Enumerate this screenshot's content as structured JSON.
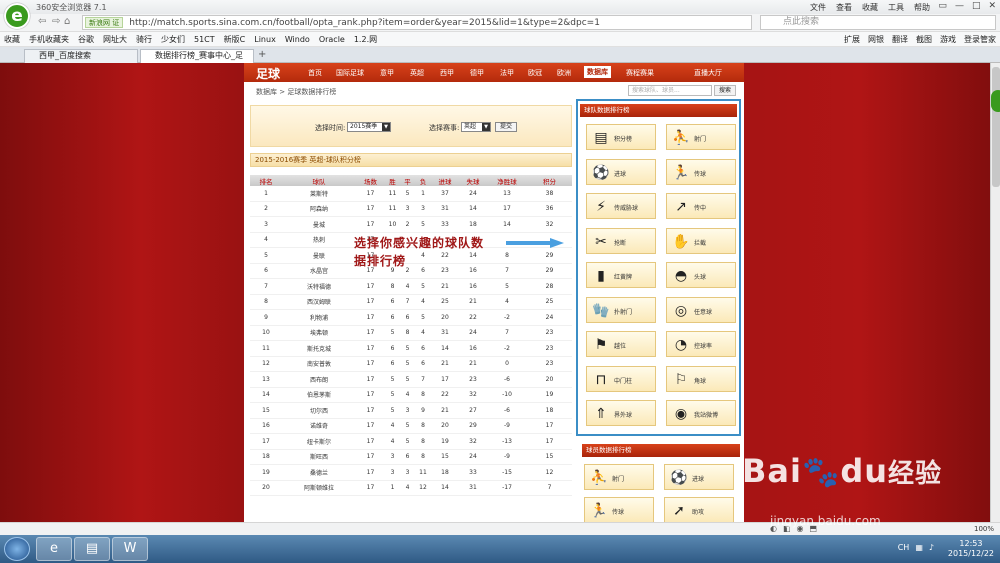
{
  "browser": {
    "title": "360安全浏览器 7.1",
    "menu": [
      "文件",
      "查看",
      "收藏",
      "工具",
      "帮助"
    ],
    "zone_badge": "新浪网",
    "zone_badge2": "证",
    "url": "http://match.sports.sina.com.cn/football/opta_rank.php?item=order&year=2015&lid=1&type=2&dpc=1",
    "search_placeholder": "点此搜索",
    "bookmarks": [
      "收藏",
      "手机收藏夹",
      "谷歌",
      "网址大",
      "骑行",
      "少女们",
      "51CT",
      "新版C",
      "Linux",
      "Windo",
      "Oracle",
      "1.2.网"
    ],
    "bookmarks_right": [
      "扩展",
      "网银",
      "翻译",
      "截图",
      "游戏",
      "登录管家"
    ],
    "tabs": [
      {
        "label": "西甲_百度搜索",
        "active": false
      },
      {
        "label": "数据排行榜_赛事中心_足",
        "active": true
      }
    ],
    "zoom": "100%",
    "clock_time": "12:53",
    "clock_date": "2015/12/22",
    "tray_lang": "CH"
  },
  "site": {
    "logo": "足球",
    "nav": [
      "首页",
      "国际足球",
      "意甲",
      "英超",
      "西甲",
      "德甲",
      "法甲",
      "欧冠",
      "欧洲",
      "数据库",
      "赛程赛果",
      "直播大厅"
    ],
    "breadcrumb": "数据库 > 足球数据排行榜",
    "search_placeholder": "搜索球队、球员...",
    "search_button": "搜索",
    "filter": {
      "time_label": "选择时间:",
      "time_value": "2015赛季",
      "event_label": "选择赛事:",
      "event_value": "英超",
      "submit": "提交"
    },
    "section_title": "2015-2016赛季 英超-球队积分榜",
    "table": {
      "headers": [
        "排名",
        "球队",
        "场数",
        "胜",
        "平",
        "负",
        "进球",
        "失球",
        "净胜球",
        "积分"
      ],
      "rows": [
        [
          "1",
          "莱斯特",
          "17",
          "11",
          "5",
          "1",
          "37",
          "24",
          "13",
          "38"
        ],
        [
          "2",
          "阿森纳",
          "17",
          "11",
          "3",
          "3",
          "31",
          "14",
          "17",
          "36"
        ],
        [
          "3",
          "曼城",
          "17",
          "10",
          "2",
          "5",
          "33",
          "18",
          "14",
          "32"
        ],
        [
          "4",
          "热刺",
          "17",
          "",
          "",
          "",
          "",
          "",
          "",
          ""
        ],
        [
          "5",
          "曼联",
          "17",
          "",
          "",
          "4",
          "22",
          "14",
          "8",
          "29"
        ],
        [
          "6",
          "水晶宫",
          "17",
          "9",
          "2",
          "6",
          "23",
          "16",
          "7",
          "29"
        ],
        [
          "7",
          "沃特福德",
          "17",
          "8",
          "4",
          "5",
          "21",
          "16",
          "5",
          "28"
        ],
        [
          "8",
          "西汉姆联",
          "17",
          "6",
          "7",
          "4",
          "25",
          "21",
          "4",
          "25"
        ],
        [
          "9",
          "利物浦",
          "17",
          "6",
          "6",
          "5",
          "20",
          "22",
          "-2",
          "24"
        ],
        [
          "10",
          "埃弗顿",
          "17",
          "5",
          "8",
          "4",
          "31",
          "24",
          "7",
          "23"
        ],
        [
          "11",
          "斯托克城",
          "17",
          "6",
          "5",
          "6",
          "14",
          "16",
          "-2",
          "23"
        ],
        [
          "12",
          "南安普敦",
          "17",
          "6",
          "5",
          "6",
          "21",
          "21",
          "0",
          "23"
        ],
        [
          "13",
          "西布朗",
          "17",
          "5",
          "5",
          "7",
          "17",
          "23",
          "-6",
          "20"
        ],
        [
          "14",
          "伯恩茅斯",
          "17",
          "5",
          "4",
          "8",
          "22",
          "32",
          "-10",
          "19"
        ],
        [
          "15",
          "切尔西",
          "17",
          "5",
          "3",
          "9",
          "21",
          "27",
          "-6",
          "18"
        ],
        [
          "16",
          "诺维奇",
          "17",
          "4",
          "5",
          "8",
          "20",
          "29",
          "-9",
          "17"
        ],
        [
          "17",
          "纽卡斯尔",
          "17",
          "4",
          "5",
          "8",
          "19",
          "32",
          "-13",
          "17"
        ],
        [
          "18",
          "斯旺西",
          "17",
          "3",
          "6",
          "8",
          "15",
          "24",
          "-9",
          "15"
        ],
        [
          "19",
          "桑德兰",
          "17",
          "3",
          "3",
          "11",
          "18",
          "33",
          "-15",
          "12"
        ],
        [
          "20",
          "阿斯顿维拉",
          "17",
          "1",
          "4",
          "12",
          "14",
          "31",
          "-17",
          "7"
        ]
      ]
    },
    "annotation_line1": "选择你感兴趣的球队数",
    "annotation_line2": "据排行榜",
    "rank_panel": {
      "title": "球队数据排行榜",
      "items": [
        {
          "label": "积分榜",
          "icon": "table-icon"
        },
        {
          "label": "射门",
          "icon": "shooting-player-icon"
        },
        {
          "label": "进球",
          "icon": "goal-icon"
        },
        {
          "label": "传球",
          "icon": "passing-player-icon"
        },
        {
          "label": "传威胁球",
          "icon": "threat-pass-icon"
        },
        {
          "label": "传中",
          "icon": "cross-player-icon"
        },
        {
          "label": "抢断",
          "icon": "tackle-icon"
        },
        {
          "label": "拦截",
          "icon": "intercept-icon"
        },
        {
          "label": "红黄牌",
          "icon": "cards-icon"
        },
        {
          "label": "头球",
          "icon": "header-icon"
        },
        {
          "label": "扑射门",
          "icon": "save-icon"
        },
        {
          "label": "任意球",
          "icon": "free-kick-icon"
        },
        {
          "label": "越位",
          "icon": "offside-flag-icon"
        },
        {
          "label": "控球率",
          "icon": "possession-icon"
        },
        {
          "label": "中门柱",
          "icon": "goalpost-icon"
        },
        {
          "label": "角球",
          "icon": "corner-icon"
        },
        {
          "label": "界外球",
          "icon": "throw-in-icon"
        },
        {
          "label": "我站微博",
          "icon": "weibo-icon"
        }
      ]
    },
    "player_panel": {
      "title": "球员数据排行榜",
      "items": [
        {
          "label": "射门",
          "icon": "shooting-player-icon"
        },
        {
          "label": "进球",
          "icon": "goal-icon"
        },
        {
          "label": "传球",
          "icon": "passing-player-icon"
        },
        {
          "label": "助攻",
          "icon": "assist-icon"
        }
      ]
    }
  },
  "watermark": {
    "brand": "Bai",
    "brand2": "du",
    "suffix": "经验",
    "url": "jingyan.baidu.com"
  },
  "colors": {
    "nav_red": "#c8361a",
    "panel_border": "#3b8ec6",
    "annotation": "#a01818",
    "background": "#a71414"
  }
}
